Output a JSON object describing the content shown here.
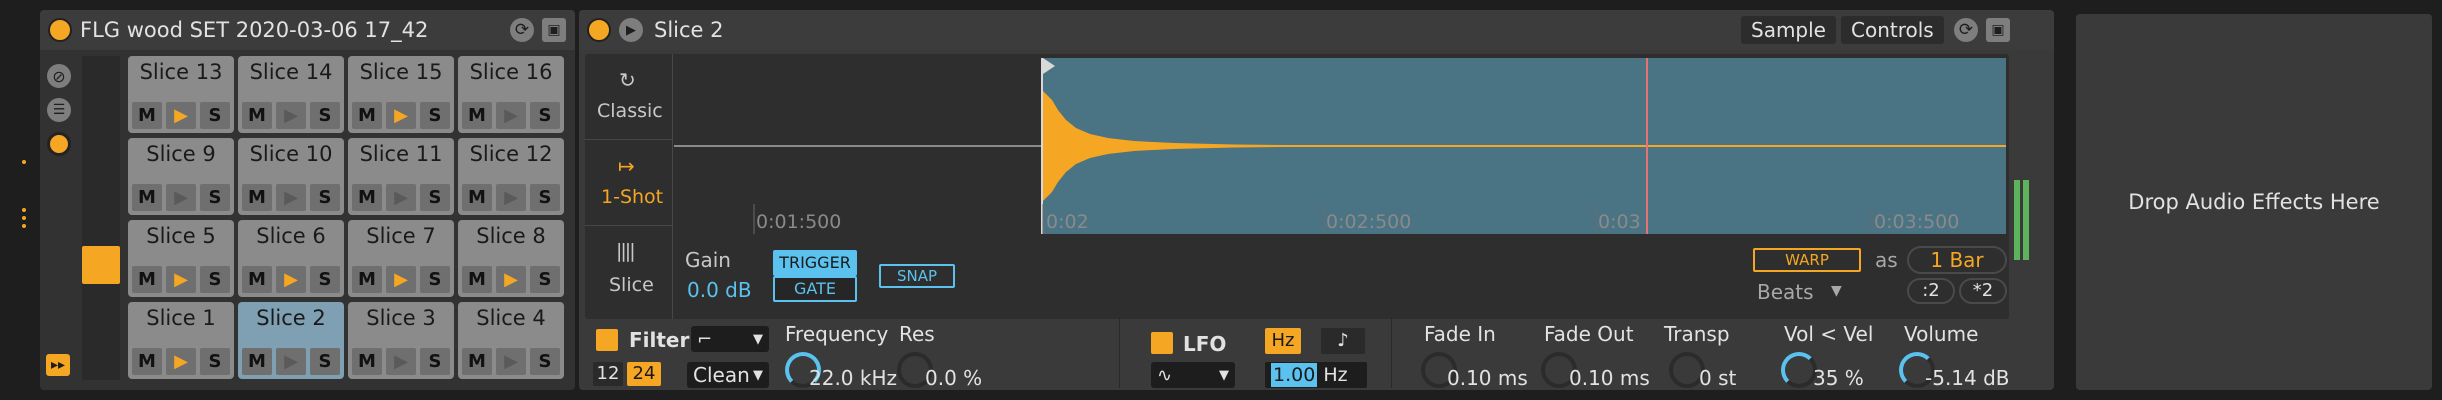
{
  "drum_rack": {
    "title": "FLG wood SET 2020-03-06 17_42",
    "pads": [
      {
        "name": "Slice 13",
        "play_active": true
      },
      {
        "name": "Slice 14",
        "play_active": false
      },
      {
        "name": "Slice 15",
        "play_active": true
      },
      {
        "name": "Slice 16",
        "play_active": false
      },
      {
        "name": "Slice 9",
        "play_active": false
      },
      {
        "name": "Slice 10",
        "play_active": false
      },
      {
        "name": "Slice 11",
        "play_active": false
      },
      {
        "name": "Slice 12",
        "play_active": false
      },
      {
        "name": "Slice 5",
        "play_active": true
      },
      {
        "name": "Slice 6",
        "play_active": true
      },
      {
        "name": "Slice 7",
        "play_active": true
      },
      {
        "name": "Slice 8",
        "play_active": true
      },
      {
        "name": "Slice 1",
        "play_active": true
      },
      {
        "name": "Slice 2",
        "play_active": false,
        "selected": true
      },
      {
        "name": "Slice 3",
        "play_active": false
      },
      {
        "name": "Slice 4",
        "play_active": false
      }
    ],
    "mute_label": "M",
    "solo_label": "S"
  },
  "simpler": {
    "title": "Slice 2",
    "tabs": [
      "Sample",
      "Controls"
    ],
    "modes": [
      {
        "label": "Classic",
        "icon": "loop-icon"
      },
      {
        "label": "1-Shot",
        "icon": "one-shot-icon",
        "active": true
      },
      {
        "label": "Slice",
        "icon": "slice-icon"
      }
    ],
    "timeline": [
      "0:01:500",
      "0:02",
      "0:02:500",
      "0:03",
      "0:03:500"
    ],
    "gain_label": "Gain",
    "gain_value": "0.0 dB",
    "trigger_label": "TRIGGER",
    "gate_label": "GATE",
    "snap_label": "SNAP",
    "warp_label": "WARP",
    "as_label": "as",
    "bars_value": "1 Bar",
    "beats_label": "Beats",
    "halve_label": ":2",
    "double_label": "*2",
    "filter": {
      "label": "Filter",
      "slope_12": "12",
      "slope_24": "24",
      "circuit": "Clean",
      "freq_label": "Frequency",
      "freq_value": "22.0 kHz",
      "res_label": "Res",
      "res_value": "0.0 %"
    },
    "lfo": {
      "label": "LFO",
      "hz_label": "Hz",
      "note_glyph": "♪",
      "rate_value": "1.00",
      "rate_unit": "Hz"
    },
    "envelope": {
      "fade_in_label": "Fade In",
      "fade_in_value": "0.10 ms",
      "fade_out_label": "Fade Out",
      "fade_out_value": "0.10 ms",
      "transp_label": "Transp",
      "transp_value": "0 st",
      "vol_vel_label": "Vol < Vel",
      "vol_vel_value": "35 %",
      "volume_label": "Volume",
      "volume_value": "-5.14 dB"
    }
  },
  "effects_drop": {
    "label": "Drop Audio Effects Here"
  },
  "colors": {
    "accent": "#f5a623",
    "waveform_bg": "#4a7384",
    "waveform": "#f5a623",
    "blue": "#5bc2f0",
    "panel": "#3a3a3a",
    "pad": "#8b8b8b",
    "pad_selected": "#7f9fb2"
  }
}
